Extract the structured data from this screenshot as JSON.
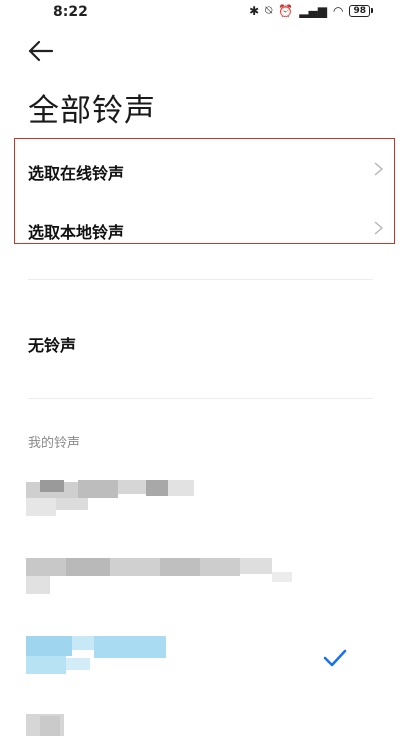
{
  "status_bar": {
    "time": "8:22",
    "battery": "98"
  },
  "header": {
    "title": "全部铃声"
  },
  "options": [
    {
      "label": "选取在线铃声"
    },
    {
      "label": "选取本地铃声"
    }
  ],
  "no_ringtone": {
    "label": "无铃声"
  },
  "my_ringtones": {
    "header": "我的铃声",
    "selected_index": 2
  },
  "colors": {
    "accent": "#1a73e8",
    "highlight_border": "#c0392b",
    "selected_blur": "#a9dcf2"
  }
}
